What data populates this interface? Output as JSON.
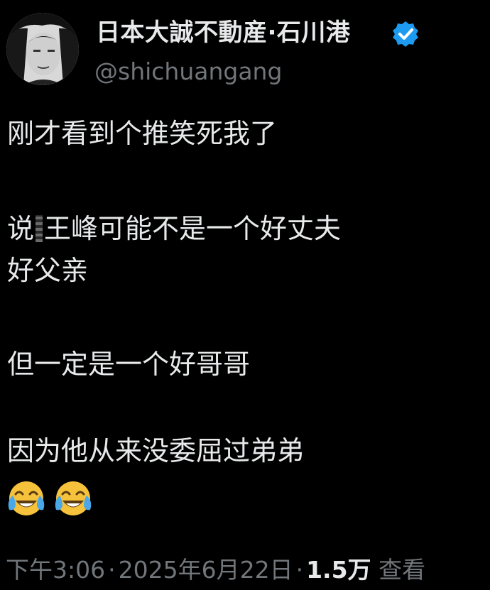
{
  "author": {
    "display_name": "日本大誠不動産·石川港",
    "handle": "@shichuangang",
    "verified": true,
    "avatar_icon": "profile-photo"
  },
  "tweet": {
    "lines": [
      "刚才看到个推笑死我了",
      "王峰可能不是一个好丈夫",
      "好父亲",
      "但一定是一个好哥哥",
      "因为他从来没委屈过弟弟"
    ],
    "line2_prefix": "说",
    "emoji": [
      "face-with-tears-of-joy-icon",
      "face-with-tears-of-joy-icon"
    ]
  },
  "meta": {
    "time": "下午3:06",
    "date": "2025年6月22日",
    "views_count": "1.5万",
    "views_label": "查看",
    "separator": "·"
  },
  "colors": {
    "background": "#000000",
    "text": "#e7e9ea",
    "secondary": "#71767b",
    "verified_badge": "#1d9bf0",
    "emoji_face": "#f7c23b"
  }
}
